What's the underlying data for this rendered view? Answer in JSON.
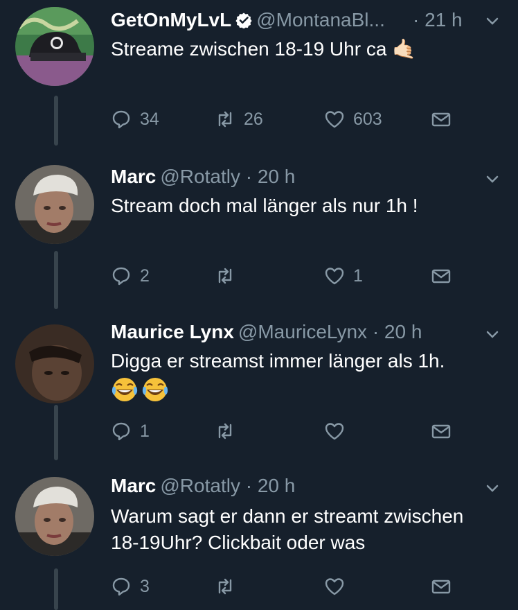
{
  "colors": {
    "background": "#16202c",
    "text_primary": "#ffffff",
    "text_secondary": "#8899a6",
    "thread_line": "#38444d",
    "verified": "#ffffff"
  },
  "tweets": [
    {
      "name": "GetOnMyLvL",
      "verified": true,
      "handle": "@MontanaBl...",
      "time": "· 21 h",
      "text_lines": [
        "Streame zwischen 18-19 Uhr ca 🤙🏻"
      ],
      "emoji": "",
      "actions": {
        "replies": "34",
        "retweets": "26",
        "likes": "603"
      },
      "icons": [
        "reply-icon",
        "retweet-icon",
        "like-icon",
        "dm-icon"
      ]
    },
    {
      "name": "Marc",
      "verified": false,
      "handle": "@Rotatly",
      "time": "· 20 h",
      "text_lines": [
        "Stream doch mal länger als nur 1h !"
      ],
      "emoji": "",
      "actions": {
        "replies": "2",
        "retweets": "",
        "likes": "1"
      }
    },
    {
      "name": "Maurice Lynx",
      "verified": false,
      "handle": "@MauriceLynx",
      "time": "· 20 h",
      "text_lines": [
        "Digga er streamst immer länger als 1h."
      ],
      "emoji": "😂😂",
      "actions": {
        "replies": "1",
        "retweets": "",
        "likes": ""
      }
    },
    {
      "name": "Marc",
      "verified": false,
      "handle": "@Rotatly",
      "time": "· 20 h",
      "text_lines": [
        "Warum sagt er dann er streamt zwischen",
        "18-19Uhr? Clickbait oder was"
      ],
      "emoji": "",
      "actions": {
        "replies": "3",
        "retweets": "",
        "likes": ""
      }
    }
  ]
}
